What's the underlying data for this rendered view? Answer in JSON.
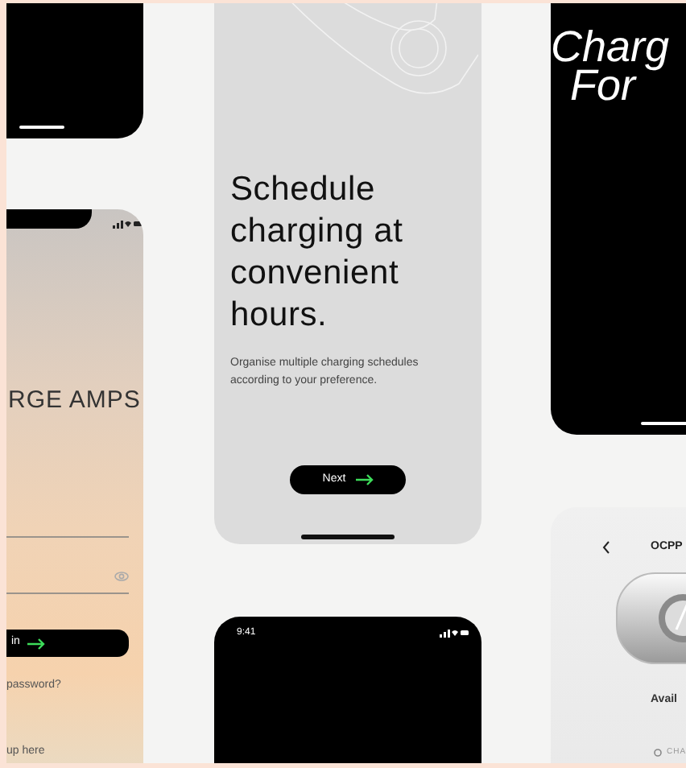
{
  "screens": [
    {
      "kind": "blank-dark"
    },
    {
      "kind": "login",
      "brand": "RGE AMPS",
      "button": "in",
      "forgot": "password?",
      "signup": "up here"
    },
    {
      "kind": "onboarding",
      "title": "Schedule charging at convenient hours.",
      "text": "Organise multiple charging schedules according to your preference.",
      "button": "Next"
    },
    {
      "kind": "promo",
      "title_lines": [
        "Charg",
        "For"
      ]
    },
    {
      "kind": "device",
      "heading": "OCPP",
      "status": "Avail",
      "footer": "CHA"
    },
    {
      "kind": "dark-status",
      "time": "9:41"
    }
  ]
}
